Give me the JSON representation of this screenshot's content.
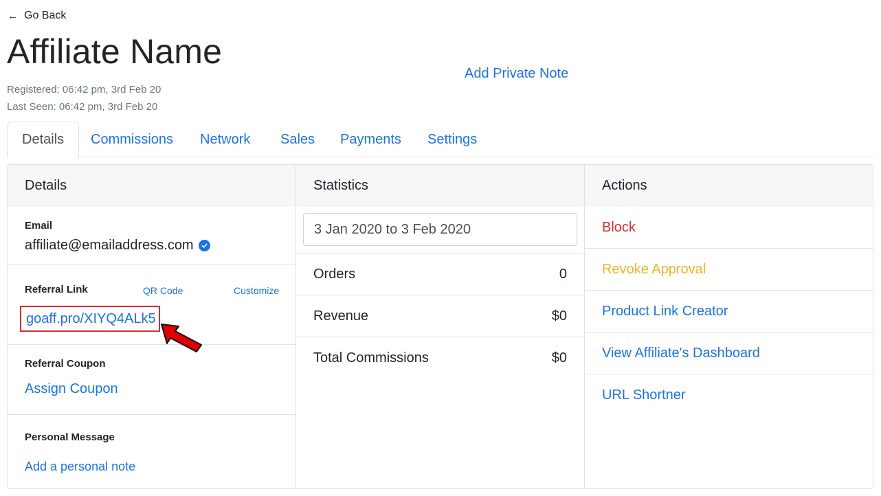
{
  "nav": {
    "back_label": "Go Back"
  },
  "header": {
    "title": "Affiliate Name",
    "registered": "Registered: 06:42 pm, 3rd Feb 20",
    "last_seen": "Last Seen: 06:42 pm, 3rd Feb 20",
    "private_note_link": "Add Private Note"
  },
  "tabs": [
    {
      "label": "Details",
      "active": true
    },
    {
      "label": "Commissions",
      "active": false
    },
    {
      "label": "Network",
      "active": false
    },
    {
      "label": "Sales",
      "active": false
    },
    {
      "label": "Payments",
      "active": false
    },
    {
      "label": "Settings",
      "active": false
    }
  ],
  "details": {
    "heading": "Details",
    "email_label": "Email",
    "email_value": "affiliate@emailaddress.com",
    "referral_label": "Referral Link",
    "qr_code": "QR Code",
    "customize": "Customize",
    "referral_link": "goaff.pro/XIYQ4ALk5",
    "coupon_label": "Referral Coupon",
    "assign_coupon": "Assign Coupon",
    "message_label": "Personal Message",
    "add_note": "Add a personal note"
  },
  "statistics": {
    "heading": "Statistics",
    "date_range": "3 Jan 2020 to 3 Feb 2020",
    "rows": [
      {
        "label": "Orders",
        "value": "0"
      },
      {
        "label": "Revenue",
        "value": "$0"
      },
      {
        "label": "Total Commissions",
        "value": "$0"
      }
    ]
  },
  "actions": {
    "heading": "Actions",
    "items": [
      {
        "label": "Block",
        "color": "#d32f2f"
      },
      {
        "label": "Revoke Approval",
        "color": "#f0b429"
      },
      {
        "label": "Product Link Creator",
        "color": "#1a73e8"
      },
      {
        "label": "View Affiliate's Dashboard",
        "color": "#1a73e8"
      },
      {
        "label": "URL Shortner",
        "color": "#1a73e8"
      }
    ]
  },
  "colors": {
    "link": "#1a73e8",
    "danger": "#d32f2f",
    "warning": "#f0b429",
    "annotation_arrow": "#e00000"
  }
}
